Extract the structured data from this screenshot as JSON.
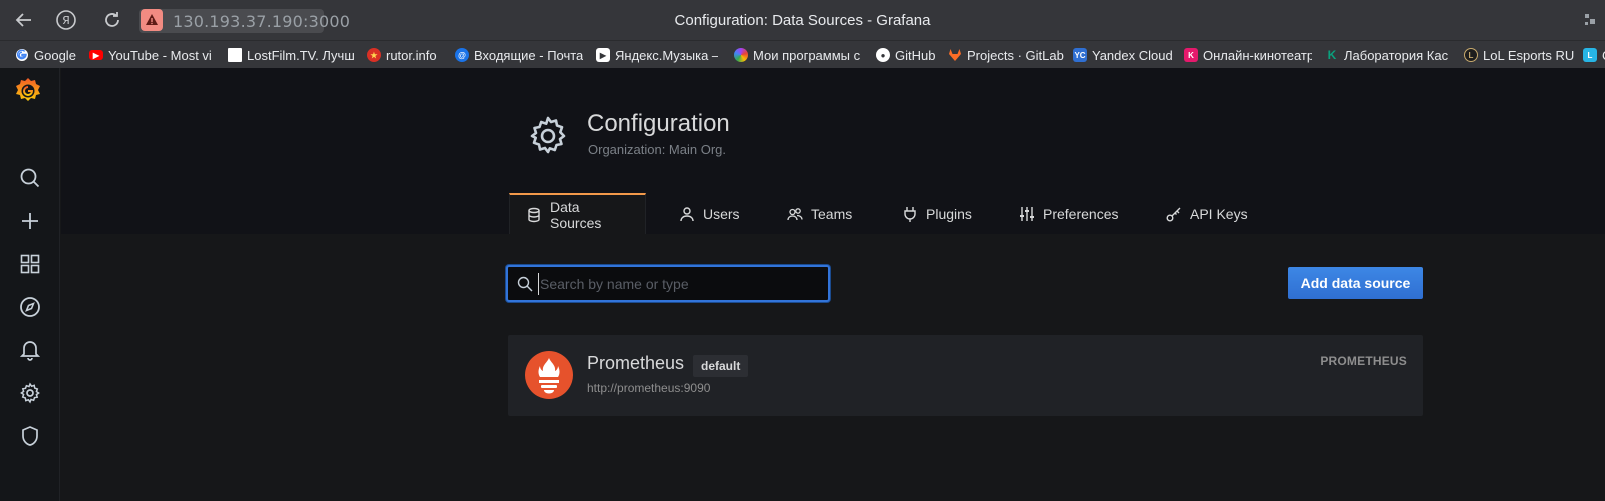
{
  "browser": {
    "address": "130.193.37.190:3000",
    "page_title": "Configuration: Data Sources - Grafana",
    "nav": {
      "back_icon": "back-arrow-icon",
      "yandex_icon": "yandex-icon",
      "reload_icon": "reload-icon",
      "not_secure_icon": "warning-icon"
    },
    "bookmarks": [
      {
        "label": "Google",
        "icon": "google-icon",
        "color": "#ffffff"
      },
      {
        "label": "YouTube - Most vi",
        "icon": "youtube-icon",
        "color": "#ff0000"
      },
      {
        "label": "LostFilm.TV. Лучш",
        "icon": "lostfilm-icon",
        "color": "#ffffff"
      },
      {
        "label": "rutor.info",
        "icon": "rutor-icon",
        "color": "#d93025"
      },
      {
        "label": "Входящие - Почта",
        "icon": "mail-icon",
        "color": "#1a73e8"
      },
      {
        "label": "Яндекс.Музыка —",
        "icon": "music-icon",
        "color": "#ffffff"
      },
      {
        "label": "Мои программы с",
        "icon": "programs-icon",
        "color": "#a142f4"
      },
      {
        "label": "GitHub",
        "icon": "github-icon",
        "color": "#ffffff"
      },
      {
        "label": "Projects · GitLab",
        "icon": "gitlab-icon",
        "color": "#fc6d26"
      },
      {
        "label": "Yandex Cloud",
        "icon": "yandex-cloud-icon",
        "color": "#2f6fd2"
      },
      {
        "label": "Онлайн-кинотеатр",
        "icon": "kinopoisk-icon",
        "color": "#e5196c"
      },
      {
        "label": "Лаборатория Кас",
        "icon": "kaspersky-icon",
        "color": "#0aa07d"
      },
      {
        "label": "LoL Esports RU",
        "icon": "lol-icon",
        "color": "#c8aa6e"
      },
      {
        "label": "C",
        "icon": "bookmark-icon",
        "color": "#27b5e5"
      }
    ]
  },
  "sidebar": {
    "logo": "grafana-logo",
    "items": [
      {
        "name": "search",
        "icon": "search-icon"
      },
      {
        "name": "create",
        "icon": "plus-icon"
      },
      {
        "name": "dashboards",
        "icon": "apps-icon"
      },
      {
        "name": "explore",
        "icon": "compass-icon"
      },
      {
        "name": "alerting",
        "icon": "bell-icon"
      },
      {
        "name": "configuration",
        "icon": "gear-icon"
      },
      {
        "name": "server-admin",
        "icon": "shield-icon"
      }
    ]
  },
  "header": {
    "icon": "gear-icon",
    "title": "Configuration",
    "subtitle": "Organization: Main Org."
  },
  "tabs": [
    {
      "label": "Data Sources",
      "icon": "database-icon",
      "active": true
    },
    {
      "label": "Users",
      "icon": "user-icon",
      "active": false
    },
    {
      "label": "Teams",
      "icon": "users-icon",
      "active": false
    },
    {
      "label": "Plugins",
      "icon": "plug-icon",
      "active": false
    },
    {
      "label": "Preferences",
      "icon": "sliders-icon",
      "active": false
    },
    {
      "label": "API Keys",
      "icon": "key-icon",
      "active": false
    }
  ],
  "search": {
    "placeholder": "Search by name or type",
    "value": ""
  },
  "add_button": "Add data source",
  "datasources": [
    {
      "name": "Prometheus",
      "badge": "default",
      "url": "http://prometheus:9090",
      "type": "PROMETHEUS",
      "logo_color": "#e6522c"
    }
  ],
  "colors": {
    "accent": "#3274d9",
    "active_tab": "#f2994a",
    "grafana_orange": "#f05a28"
  }
}
